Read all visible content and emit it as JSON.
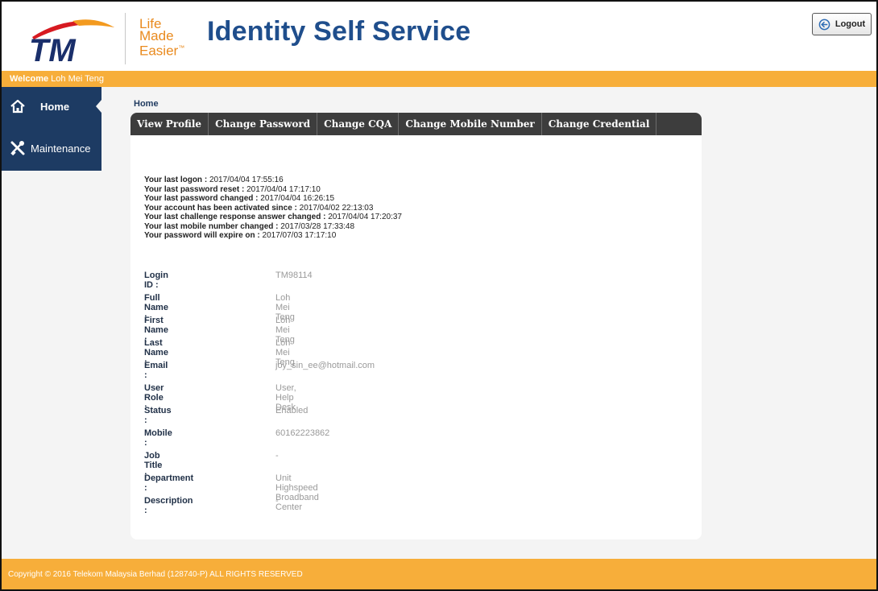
{
  "header": {
    "brand": "TM",
    "tagline": [
      "Life",
      "Made",
      "Easier"
    ],
    "tagline_mark": "™",
    "title": "Identity Self Service",
    "logout_label": "Logout"
  },
  "welcome": {
    "prefix": "Welcome",
    "user": "Loh Mei Teng"
  },
  "sidebar": {
    "items": [
      {
        "label": "Home",
        "icon": "home-icon",
        "active": true
      },
      {
        "label": "Maintenance",
        "icon": "tools-icon",
        "active": false
      }
    ]
  },
  "breadcrumb": "Home",
  "tabs": [
    "View Profile",
    "Change Password",
    "Change CQA",
    "Change Mobile Number",
    "Change Credential"
  ],
  "last_info": [
    {
      "label": "Your last logon :",
      "value": "2017/04/04 17:55:16"
    },
    {
      "label": "Your last password reset :",
      "value": "2017/04/04 17:17:10"
    },
    {
      "label": "Your last password changed :",
      "value": "2017/04/04 16:26:15"
    },
    {
      "label": "Your account has been activated since :",
      "value": "2017/04/02 22:13:03"
    },
    {
      "label": "Your last challenge response answer changed :",
      "value": "2017/04/04 17:20:37"
    },
    {
      "label": "Your last mobile number changed :",
      "value": "2017/03/28 17:33:48"
    },
    {
      "label": "Your password will expire on :",
      "value": "2017/07/03 17:17:10"
    }
  ],
  "profile": [
    {
      "label": "Login ID :",
      "value": "TM98114"
    },
    {
      "label": "Full Name :",
      "value": "Loh Mei Teng"
    },
    {
      "label": "First Name :",
      "value": "Loh Mei Teng"
    },
    {
      "label": "Last Name :",
      "value": "Loh Mei Teng"
    },
    {
      "label": "Email :",
      "value": "joy_sin_ee@hotmail.com"
    },
    {
      "label": "User Role :",
      "value": "User, Help Desk"
    },
    {
      "label": "Status :",
      "value": "Enabled"
    },
    {
      "label": "Mobile :",
      "value": "60162223862"
    },
    {
      "label": "Job Title :",
      "value": "-"
    },
    {
      "label": "Department :",
      "value": "Unit Highspeed Broadband Center"
    },
    {
      "label": "Description :",
      "value": "-"
    }
  ],
  "footer": "Copyright © 2016 Telekom Malaysia Berhad (128740-P) ALL RIGHTS RESERVED",
  "colors": {
    "accent_orange": "#f7ae3a",
    "sidebar_navy": "#1d3b63",
    "title_blue": "#1f4e8c",
    "tm_red": "#d71a21",
    "tm_navy": "#1a2f6b",
    "tabbar_dark": "#3d3d3d"
  }
}
